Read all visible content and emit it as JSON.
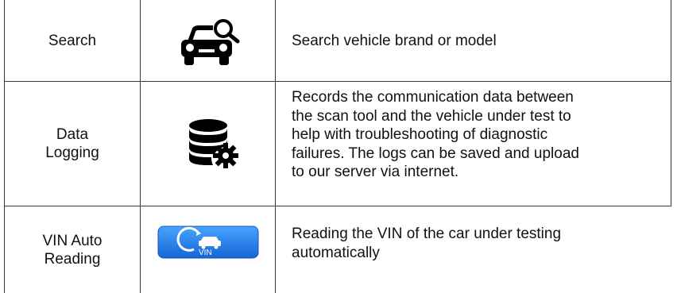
{
  "rows": [
    {
      "name_lines": [
        "Search"
      ],
      "icon": "car-search-icon",
      "description_lines": [
        "Search vehicle brand or model"
      ]
    },
    {
      "name_lines": [
        "Data",
        "Logging"
      ],
      "icon": "database-gear-icon",
      "description_lines": [
        "Records the communication data between",
        "the scan tool and the vehicle under test to",
        "help with troubleshooting of diagnostic",
        "failures. The logs can be saved and upload",
        "to our server via internet."
      ]
    },
    {
      "name_lines": [
        "VIN Auto",
        "Reading"
      ],
      "icon": "vin-car-icon",
      "icon_text": "VIN",
      "icon_color": "#1e7fe6",
      "description_lines": [
        "Reading the VIN of the car under testing",
        "automatically"
      ]
    }
  ]
}
